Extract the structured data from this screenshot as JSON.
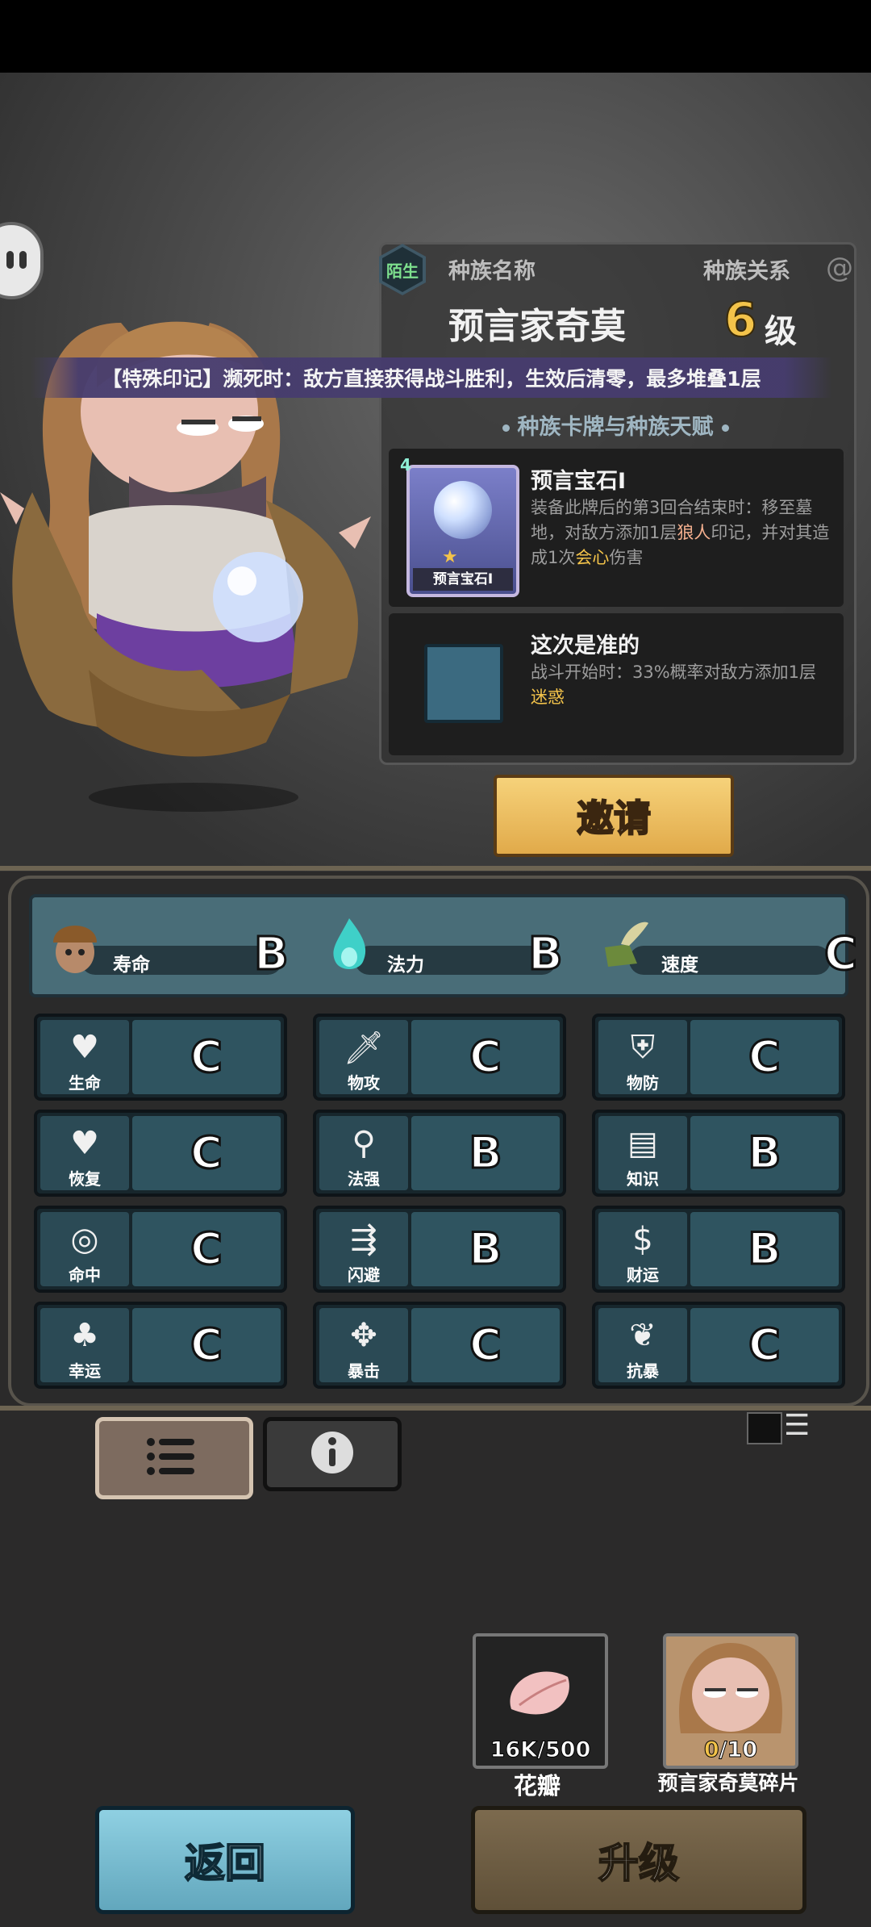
{
  "race": {
    "relation_badge": "陌生",
    "name_label": "种族名称",
    "relation_label": "种族关系",
    "character_name": "预言家奇莫",
    "level_value": "6",
    "level_unit": "级"
  },
  "banner_text": "【特殊印记】濒死时：敌方直接获得战斗胜利，生效后清零，最多堆叠1层",
  "talents": {
    "heading": "种族卡牌与种族天赋",
    "card": {
      "rank": "4",
      "title": "预言宝石Ⅰ",
      "icon_caption": "预言宝石Ⅰ",
      "desc_part1": "装备此牌后的第3回合结束时：移至墓地，对敌方添加1层",
      "desc_highlight1": "狼人",
      "desc_part2": "印记，并对其造成1次",
      "desc_highlight2": "会心",
      "desc_part3": "伤害"
    },
    "talent": {
      "title": "这次是准的",
      "desc_part1": "战斗开始时：33%概率对敌方添加1层",
      "desc_highlight": "迷惑"
    }
  },
  "invite_label": "邀请",
  "primary_stats": [
    {
      "label": "寿命",
      "grade": "B",
      "icon": "acorn-creature-icon"
    },
    {
      "label": "法力",
      "grade": "B",
      "icon": "blue-flame-icon"
    },
    {
      "label": "速度",
      "grade": "C",
      "icon": "winged-boot-icon"
    }
  ],
  "stats": [
    {
      "label": "生命",
      "grade": "C",
      "icon": "heart-icon"
    },
    {
      "label": "物攻",
      "grade": "C",
      "icon": "sword-icon"
    },
    {
      "label": "物防",
      "grade": "C",
      "icon": "armor-icon"
    },
    {
      "label": "恢复",
      "grade": "C",
      "icon": "heart-plus-icon"
    },
    {
      "label": "法强",
      "grade": "B",
      "icon": "staff-icon"
    },
    {
      "label": "知识",
      "grade": "B",
      "icon": "book-icon"
    },
    {
      "label": "命中",
      "grade": "C",
      "icon": "target-icon"
    },
    {
      "label": "闪避",
      "grade": "B",
      "icon": "dodge-arrows-icon"
    },
    {
      "label": "财运",
      "grade": "B",
      "icon": "coin-icon"
    },
    {
      "label": "幸运",
      "grade": "C",
      "icon": "clover-icon"
    },
    {
      "label": "暴击",
      "grade": "C",
      "icon": "crit-dagger-icon"
    },
    {
      "label": "抗暴",
      "grade": "C",
      "icon": "crit-shield-icon"
    }
  ],
  "items": {
    "petal_count": "16K/500",
    "petal_label": "花瓣",
    "shard_count_have": "0",
    "shard_count_need": "/10",
    "shard_label": "预言家奇莫碎片"
  },
  "buttons": {
    "back": "返回",
    "upgrade": "升级"
  },
  "colors": {
    "accent_gold": "#f3c34a",
    "stat_teal": "#2f5460",
    "back_blue": "#62a7bd"
  }
}
